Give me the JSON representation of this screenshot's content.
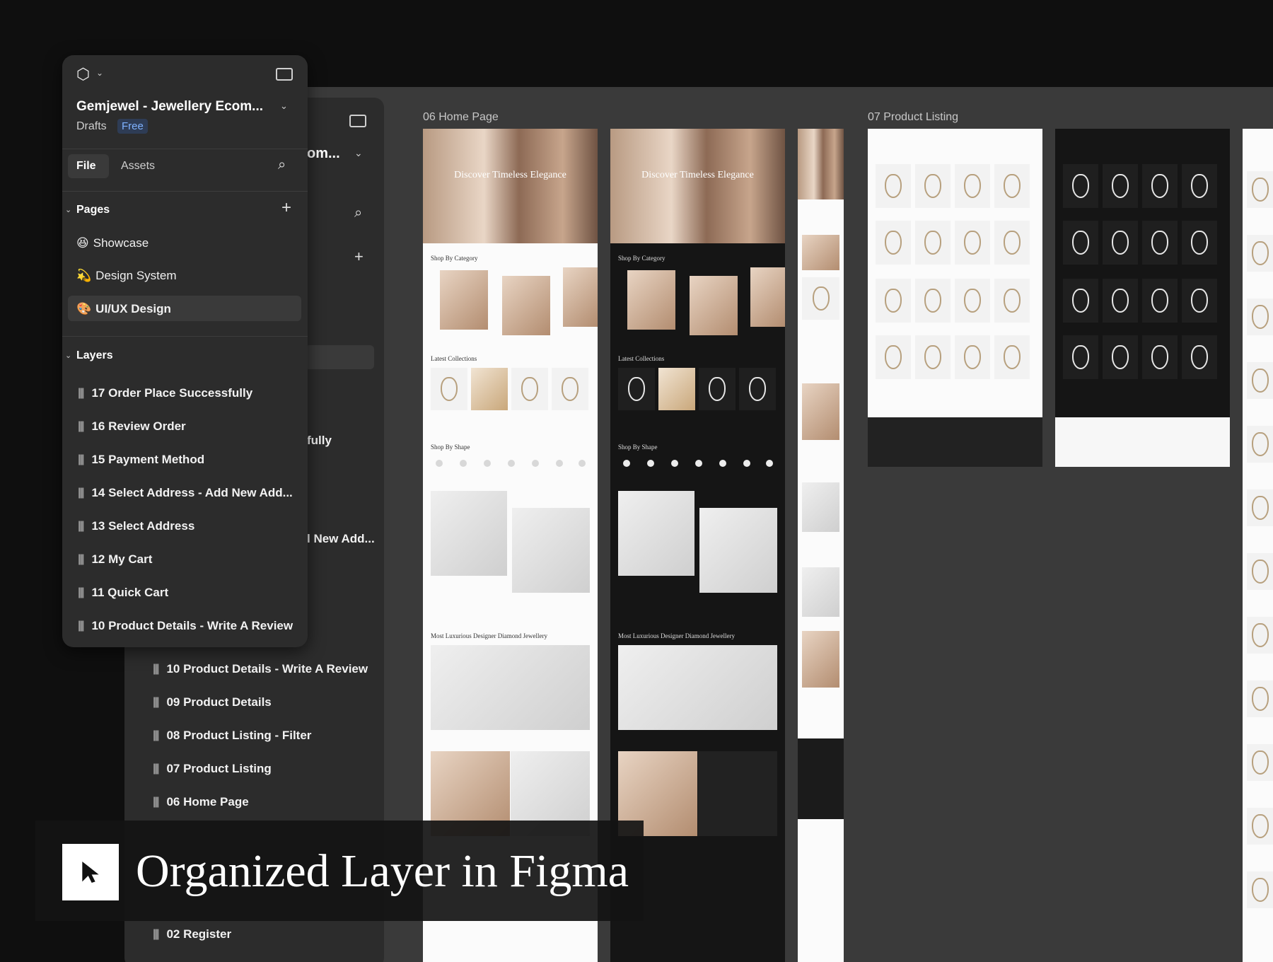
{
  "app": {
    "file_title": "Gemjewel - Jewellery Ecom...",
    "file_title_back_fragment": "om...",
    "location": "Drafts",
    "plan_badge": "Free"
  },
  "tabs": {
    "file": "File",
    "assets": "Assets"
  },
  "pages": {
    "heading": "Pages",
    "items": [
      {
        "emoji": "😆",
        "label": "Showcase"
      },
      {
        "emoji": "💫",
        "label": "Design System"
      },
      {
        "emoji": "🎨",
        "label": "UI/UX Design"
      }
    ]
  },
  "layers": {
    "heading": "Layers",
    "items": [
      "17 Order Place Successfully",
      "16 Review Order",
      "15 Payment Method",
      "14 Select Address - Add New Add...",
      "13 Select Address",
      "12 My Cart",
      "11 Quick Cart",
      "10 Product Details - Write A Review"
    ]
  },
  "back_layers": {
    "fragment_1": "fully",
    "fragment_2": "l New Add...",
    "items": [
      "10 Product Details - Write A Review",
      "09 Product Details",
      "08 Product Listing - Filter",
      "07 Product Listing",
      "06 Home Page",
      "02 Register"
    ]
  },
  "canvas": {
    "frame_labels": [
      "06 Home Page",
      "07 Product Listing"
    ],
    "home": {
      "hero_text": "Discover Timeless Elegance",
      "shop_by_category": "Shop By Category",
      "latest_collections": "Latest Collections",
      "shop_by_shape": "Shop By Shape",
      "designer_section": "Most Luxurious Designer Diamond Jewellery"
    }
  },
  "banner": {
    "text": "Organized Layer in Figma",
    "icon": "cursor-arrow-icon"
  },
  "colors": {
    "canvas": "#3a3a3a",
    "panel": "#2c2c2c",
    "accent_badge": "#4a8dff"
  }
}
